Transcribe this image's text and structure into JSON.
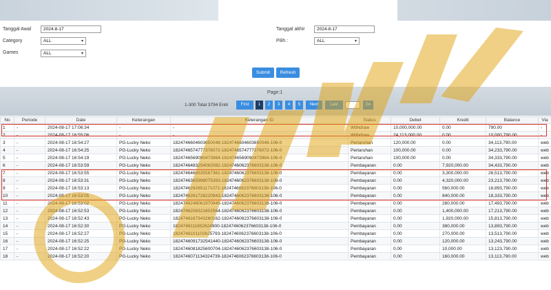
{
  "filters": {
    "tanggal_awal_label": "Tanggal Awal",
    "tanggal_awal_value": "2024-8-17",
    "tanggal_akhir_label": "Tanggal akhir",
    "tanggal_akhir_value": "2024-8-17",
    "category_label": "Category",
    "category_value": "ALL",
    "pilih_label": "Pilih :",
    "pilih_value": "ALL",
    "games_label": "Games",
    "games_value": "ALL",
    "submit_label": "Submit",
    "refresh_label": "Refresh"
  },
  "pagination": {
    "page_label": "Page:1",
    "total_text": "1-300 Total 3794 Entri",
    "first_label": "First",
    "pages": [
      "1",
      "2",
      "3",
      "4",
      "5"
    ],
    "active_page": "1",
    "next_label": "Next",
    "last_label": "Last",
    "go_label": "Go"
  },
  "table": {
    "headers": [
      "No",
      "Periode",
      "Date",
      "Keterangan",
      "Keterangan ID",
      "Status",
      "Debet",
      "Kredit",
      "Balance",
      "Via"
    ],
    "rows": [
      [
        "1",
        "-",
        "2024-08-17 17:06:34",
        "-",
        "-",
        "Withdraw",
        "10,000,000.00",
        "0.00",
        "790.00",
        "-"
      ],
      [
        "2",
        "-",
        "2024-08-17 16:55:06",
        "-",
        "-",
        "Withdraw",
        "24,113,000.00",
        "0.00",
        "10,000,790.00",
        "-"
      ],
      [
        "3",
        "-",
        "2024-08-17 16:54:27",
        "PG-Lucky Neko",
        "1824746604603650048-1824746604603650048-106-0",
        "Pertaruhan",
        "120,000.00",
        "0.00",
        "34,113,790.00",
        "web"
      ],
      [
        "4",
        "-",
        "2024-08-17 16:54:25",
        "PG-Lucky Neko",
        "1824746574777376072-1824746574777376072-106-0",
        "Pertaruhan",
        "100,000.00",
        "0.00",
        "34,233,790.00",
        "web"
      ],
      [
        "5",
        "-",
        "2024-08-17 16:54:19",
        "PG-Lucky Neko",
        "1824746569090473984-1824746569090473984-106-0",
        "Pertaruhan",
        "100,000.00",
        "0.00",
        "34,333,790.00",
        "web"
      ],
      [
        "6",
        "-",
        "2024-08-17 16:53:59",
        "PG-Lucky Neko",
        "1824746483254062082-1824746062376603138-106-0",
        "Pembayaran",
        "0.00",
        "7,920,000.00",
        "34,433,790.00",
        "web"
      ],
      [
        "7",
        "-",
        "2024-08-17 16:53:55",
        "PG-Lucky Neko",
        "1824746466535567361-1824746062376603138-106-0",
        "Pembayaran",
        "0.00",
        "3,300,000.00",
        "26,513,790.00",
        "web"
      ],
      [
        "8",
        "-",
        "2024-08-17 16:53:31",
        "PG-Lucky Neko",
        "1824746365998075393-1824746062376603138-106-0",
        "Pembayaran",
        "0.00",
        "4,320,000.00",
        "23,213,790.00",
        "web"
      ],
      [
        "9",
        "-",
        "2024-08-17 16:53:13",
        "PG-Lucky Neko",
        "1824746292651171072-1824746062376603138-106-0",
        "Pembayaran",
        "0.00",
        "560,000.00",
        "18,893,790.00",
        "web"
      ],
      [
        "10",
        "-",
        "2024-08-17 16:53:05",
        "PG-Lucky Neko",
        "1824746261728220943-1824746062376603138-106-0",
        "Pembayaran",
        "0.00",
        "840,000.00",
        "18,333,790.00",
        "web"
      ],
      [
        "11",
        "-",
        "2024-08-17 16:53:02",
        "PG-Lucky Neko",
        "1824746246061970945-1824746062376603138-106-0",
        "Pembayaran",
        "0.00",
        "280,000.00",
        "17,493,790.00",
        "web"
      ],
      [
        "12",
        "-",
        "2024-08-17 16:52:53",
        "PG-Lucky Neko",
        "1824746208321602564-1824746062376603138-106-0",
        "Pembayaran",
        "0.00",
        "1,400,000.00",
        "17,213,790.00",
        "web"
      ],
      [
        "13",
        "-",
        "2024-08-17 16:52:43",
        "PG-Lucky Neko",
        "1824746167343260162-1824746062376603138-106-0",
        "Pembayaran",
        "0.00",
        "1,920,000.00",
        "15,813,790.00",
        "web"
      ],
      [
        "14",
        "-",
        "2024-08-17 16:52:30",
        "PG-Lucky Neko",
        "1824746111852624900-1824746062376603138-106-0",
        "Pembayaran",
        "0.00",
        "380,000.00",
        "13,893,790.00",
        "web"
      ],
      [
        "15",
        "-",
        "2024-08-17 16:52:27",
        "PG-Lucky Neko",
        "1824746101102625793-1824746062376603138-106-0",
        "Pembayaran",
        "0.00",
        "270,000.00",
        "13,513,790.00",
        "web"
      ],
      [
        "16",
        "-",
        "2024-08-17 16:52:25",
        "PG-Lucky Neko",
        "1824746091732541440-1824746062376603138-106-0",
        "Pembayaran",
        "0.00",
        "120,000.00",
        "13,243,790.00",
        "web"
      ],
      [
        "17",
        "-",
        "2024-08-17 16:52:22",
        "PG-Lucky Neko",
        "1824746081825600704-1824746062376603138-106-0",
        "Pembayaran",
        "0.00",
        "10,000.00",
        "13,123,790.00",
        "web"
      ],
      [
        "18",
        "-",
        "2024-08-17 16:52:20",
        "PG-Lucky Neko",
        "1824746071134324739-1824746062376603138-106-0",
        "Pembayaran",
        "0.00",
        "160,000.00",
        "13,113,790.00",
        "web"
      ]
    ]
  },
  "colors": {
    "accent_blue": "#3a8de0",
    "active_page": "#1d3d66",
    "debet_red": "#d9251c",
    "highlight_red": "#d9322a",
    "link_blue": "#2a73c9"
  },
  "icons": {
    "select_chevron": "chevron-down-icon"
  }
}
